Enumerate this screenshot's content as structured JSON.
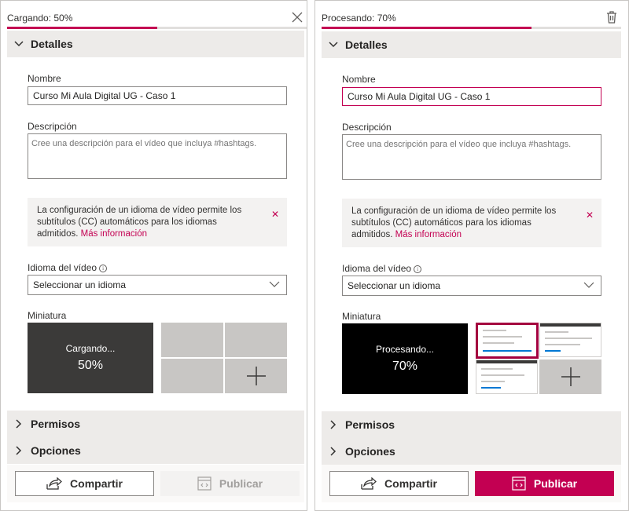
{
  "colors": {
    "accent": "#c30052",
    "track": "#e1dfdd",
    "section_bg": "#edebe9"
  },
  "left": {
    "status": "Cargando: 50%",
    "progress_fraction": 0.5,
    "close_icon": "close-icon",
    "sections": {
      "details": "Detalles",
      "permissions": "Permisos",
      "options": "Opciones"
    },
    "name_label": "Nombre",
    "name_value": "Curso Mi Aula Digital UG - Caso 1",
    "description_label": "Descripción",
    "description_placeholder": "Cree una descripción para el vídeo que incluya #hashtags.",
    "info_text": "La configuración de un idioma de vídeo permite los subtítulos (CC) automáticos para los idiomas admitidos.",
    "info_link": "Más información",
    "language_label": "Idioma del vídeo",
    "language_value": "Seleccionar un idioma",
    "thumbnail_label": "Miniatura",
    "thumb_status": "Cargando...",
    "thumb_percent": "50%",
    "share_label": "Compartir",
    "publish_label": "Publicar"
  },
  "right": {
    "status": "Procesando: 70%",
    "progress_fraction": 0.7,
    "delete_icon": "trash-icon",
    "sections": {
      "details": "Detalles",
      "permissions": "Permisos",
      "options": "Opciones"
    },
    "name_label": "Nombre",
    "name_value": "Curso Mi Aula Digital UG - Caso 1",
    "description_label": "Descripción",
    "description_placeholder": "Cree una descripción para el vídeo que incluya #hashtags.",
    "info_text": "La configuración de un idioma de vídeo permite los subtítulos (CC) automáticos para los idiomas admitidos.",
    "info_link": "Más información",
    "language_label": "Idioma del vídeo",
    "language_value": "Seleccionar un idioma",
    "thumbnail_label": "Miniatura",
    "thumb_status": "Procesando...",
    "thumb_percent": "70%",
    "share_label": "Compartir",
    "publish_label": "Publicar"
  }
}
